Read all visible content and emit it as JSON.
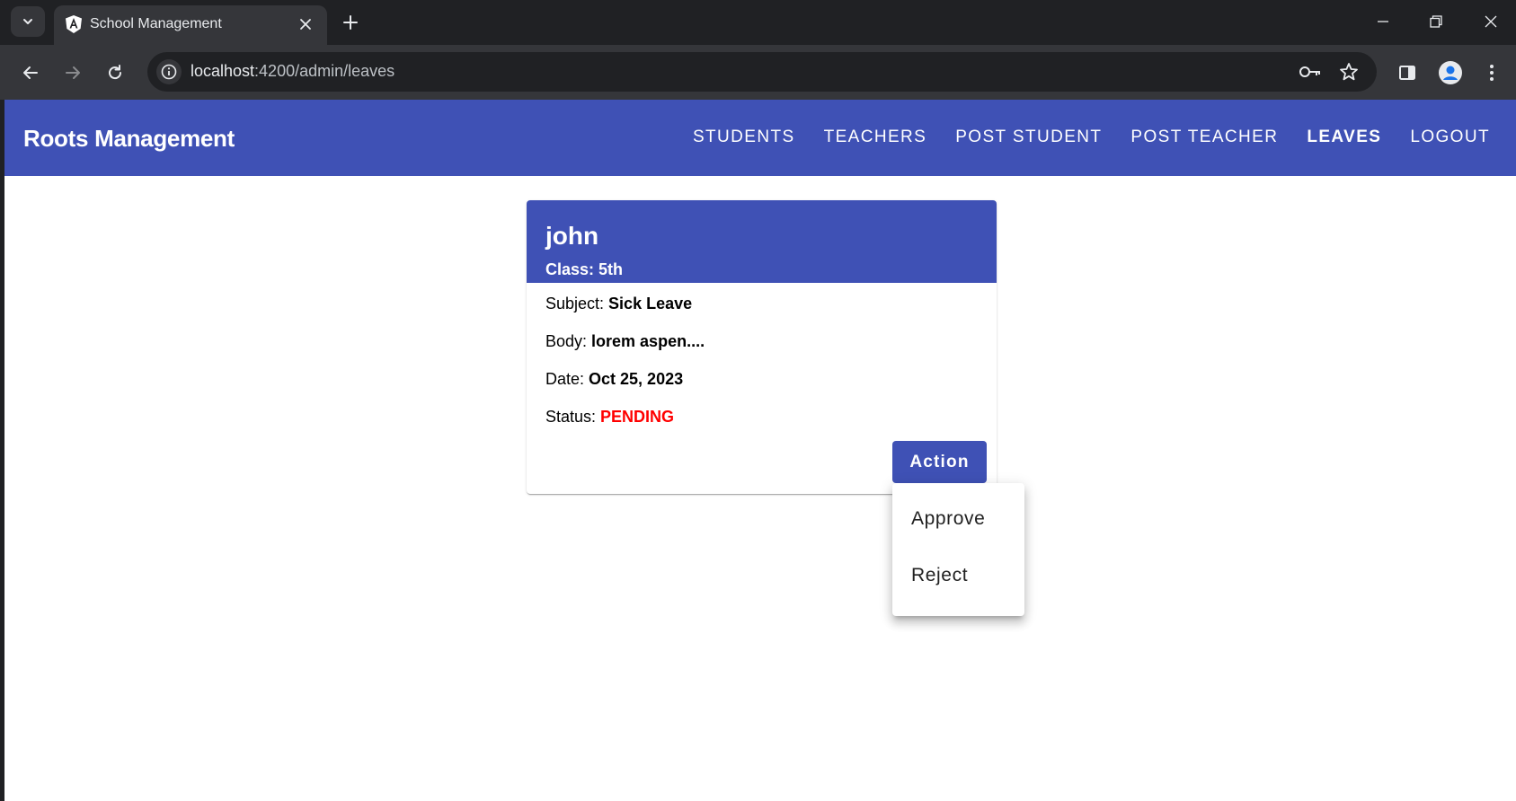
{
  "browser": {
    "tab_title": "School Management",
    "url_host": "localhost",
    "url_path": ":4200/admin/leaves"
  },
  "app": {
    "brand": "Roots Management",
    "nav": [
      {
        "label": "STUDENTS",
        "active": false
      },
      {
        "label": "TEACHERS",
        "active": false
      },
      {
        "label": "POST STUDENT",
        "active": false
      },
      {
        "label": "POST TEACHER",
        "active": false
      },
      {
        "label": "LEAVES",
        "active": true
      },
      {
        "label": "LOGOUT",
        "active": false
      }
    ],
    "colors": {
      "primary": "#3f51b5",
      "status_pending": "#ff0000"
    }
  },
  "leave_card": {
    "name": "john",
    "class_label": "Class: ",
    "class_value": "5th",
    "subject_label": "Subject: ",
    "subject_value": "Sick Leave",
    "body_label": "Body: ",
    "body_value": "lorem aspen....",
    "date_label": "Date: ",
    "date_value": "Oct 25, 2023",
    "status_label": "Status: ",
    "status_value": "PENDING",
    "action_label": "Action"
  },
  "action_menu": {
    "items": [
      "Approve",
      "Reject"
    ]
  }
}
